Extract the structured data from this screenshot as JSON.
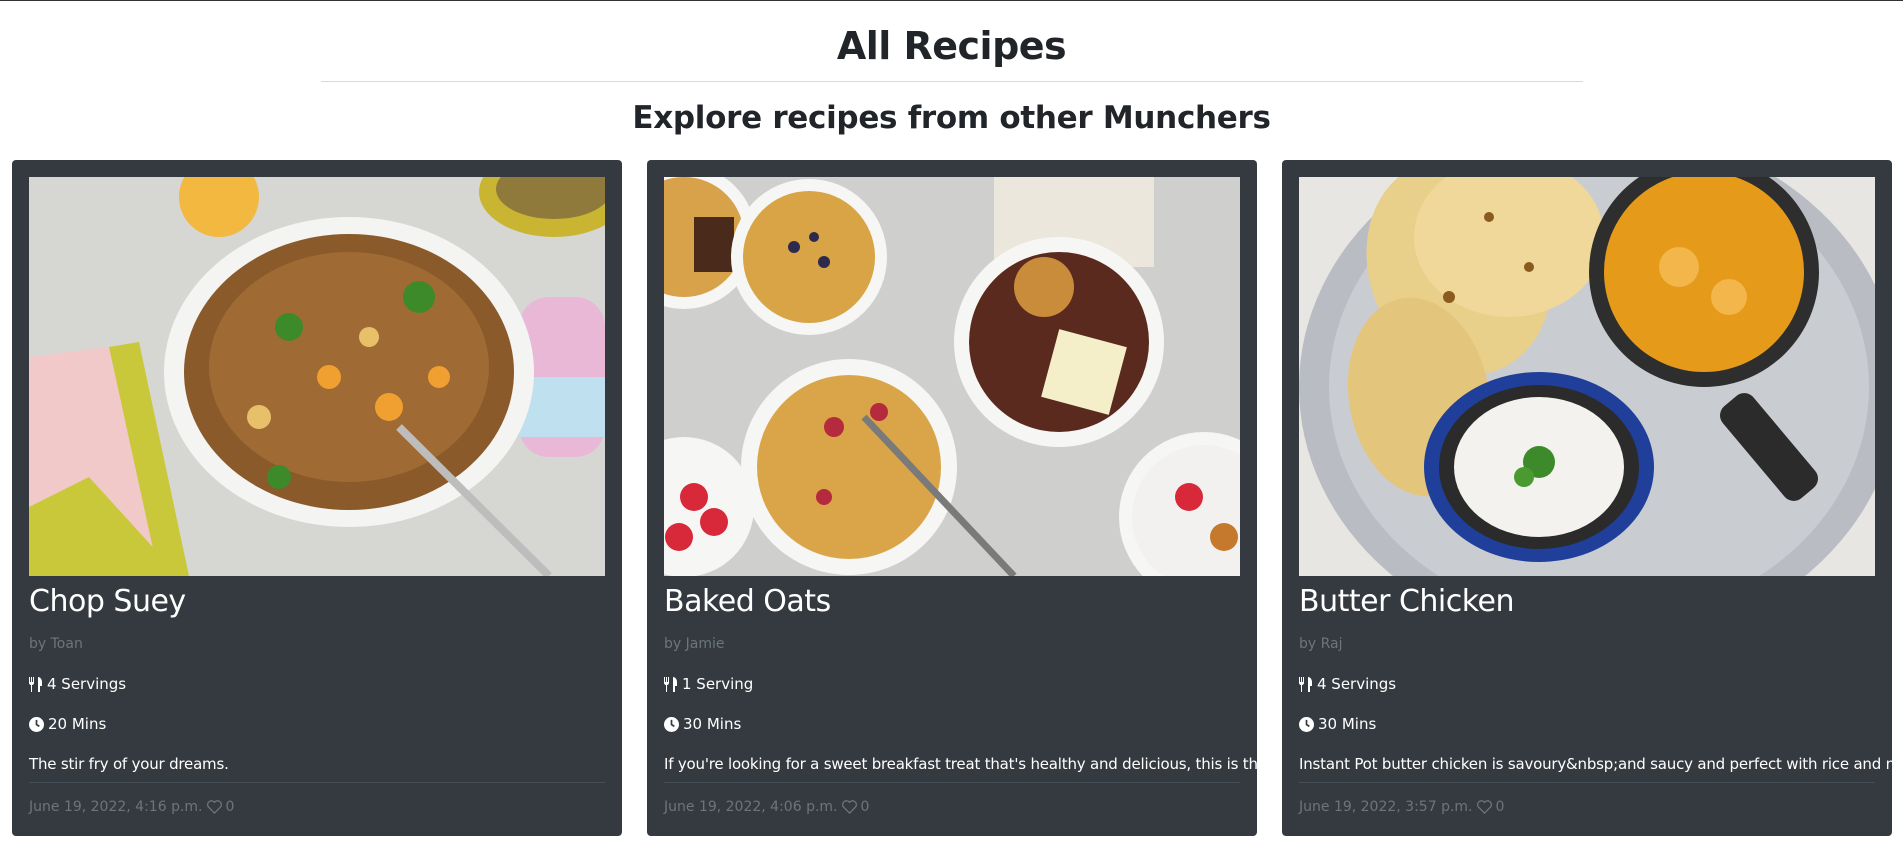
{
  "page": {
    "title": "All Recipes",
    "subtitle": "Explore recipes from other Munchers"
  },
  "recipes": [
    {
      "title": "Chop Suey",
      "author": "by Toan",
      "servings": "4 Servings",
      "time": "20 Mins",
      "description": "The stir fry of your dreams.",
      "date": "June 19, 2022, 4:16 p.m.",
      "likes": "0",
      "image": "chop-suey-bowl"
    },
    {
      "title": "Baked Oats",
      "author": "by Jamie",
      "servings": "1 Serving",
      "time": "30 Mins",
      "description": "If you're looking for a sweet breakfast treat that's healthy and delicious, this is the one.",
      "date": "June 19, 2022, 4:06 p.m.",
      "likes": "0",
      "image": "baked-oats-ramekins"
    },
    {
      "title": "Butter Chicken",
      "author": "by Raj",
      "servings": "4 Servings",
      "time": "30 Mins",
      "description": "Instant Pot butter chicken is savoury&nbsp;and saucy and perfect with rice and naan.",
      "date": "June 19, 2022, 3:57 p.m.",
      "likes": "0",
      "image": "butter-chicken-platter"
    }
  ],
  "icons": {
    "servings": "utensils-icon",
    "time": "clock-icon",
    "likes": "heart-outline-icon"
  },
  "colors": {
    "card_bg": "#343a40",
    "muted": "#6c757d",
    "text": "#212529"
  }
}
